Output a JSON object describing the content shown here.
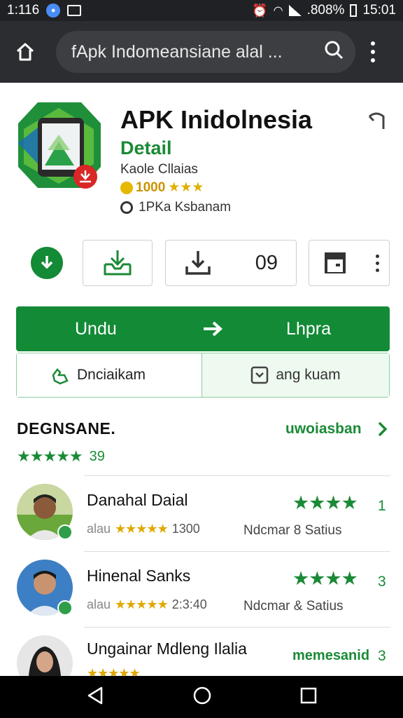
{
  "status_bar": {
    "time_left": "1:116",
    "battery": ".808%",
    "time_right": "15:01"
  },
  "browser": {
    "url": "fApk Indomeansiane alal ...",
    "home_icon": "home-icon",
    "search_icon": "search-icon",
    "menu_icon": "more-vert-icon"
  },
  "app": {
    "title": "APK Inidolnesia",
    "subtitle": "Detail",
    "developer": "Kaole Cllaias",
    "rating_text": "1000",
    "rating_stars": "★★★",
    "size_text": "1PKa Ksbanam",
    "accent_color": "#138a36"
  },
  "actions": {
    "count_value": "09"
  },
  "main_button": {
    "left_label": "Undu",
    "right_label": "Lhpra"
  },
  "split_button": {
    "left_label": "Dnciaikam",
    "right_label": "ang kuam"
  },
  "reviews": {
    "title": "DEGNSANE.",
    "link": "uwoiasban",
    "stars": "★★★★★",
    "count": "39",
    "items": [
      {
        "name": "Danahal Daial",
        "meta_prefix": "alau",
        "meta_stars": "★★★★★",
        "meta_value": "1300",
        "stars": "★★★★",
        "num": "1",
        "status": "Ndcmar 8 Satius"
      },
      {
        "name": "Hinenal Sanks",
        "meta_prefix": "alau",
        "meta_stars": "★★★★★",
        "meta_value": "2:3:40",
        "stars": "★★★★",
        "num": "3",
        "status": "Ndcmar & Satius"
      },
      {
        "name": "Ungainar Mdleng Ilalia",
        "link": "memesanid",
        "num": "3",
        "meta_stars": "★★★★★"
      }
    ]
  }
}
